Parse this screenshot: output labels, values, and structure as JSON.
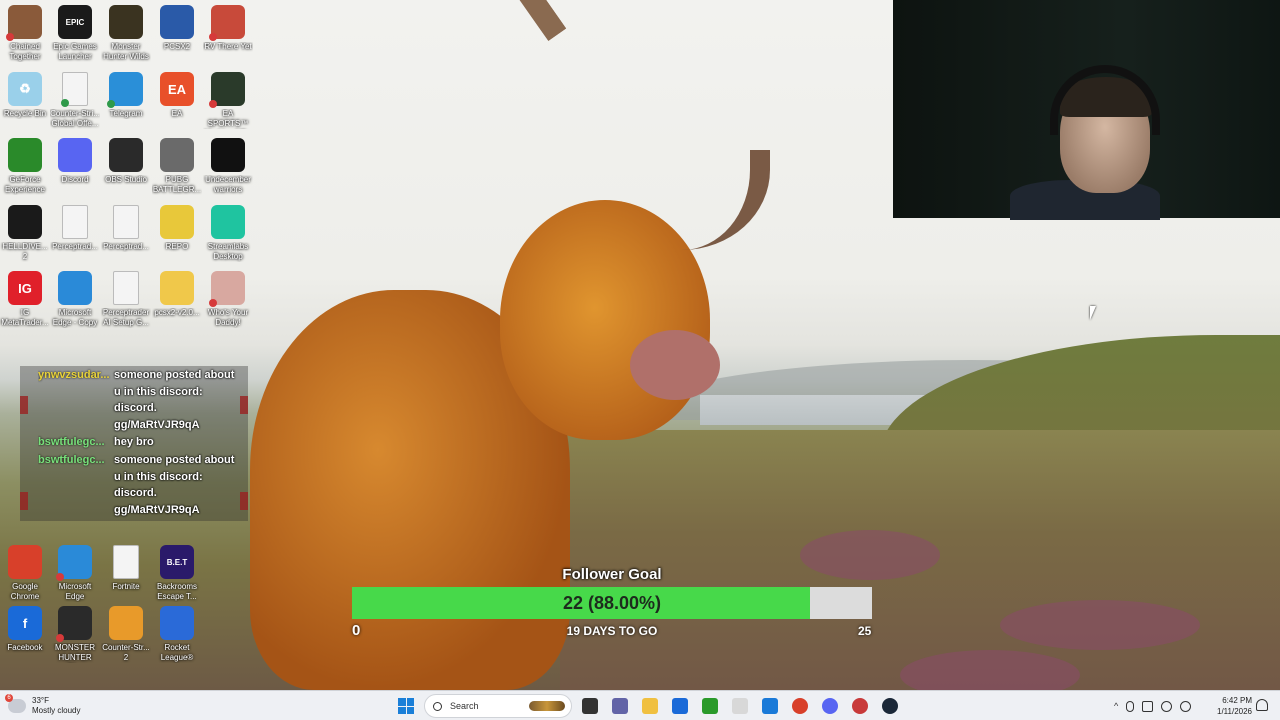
{
  "desktop_icons": [
    {
      "label": "Chained Together",
      "icon": "chained-together-icon",
      "color": "#8a5a3a",
      "glyph": "",
      "badge": "err"
    },
    {
      "label": "Epic Games Launcher",
      "icon": "epic-games-icon",
      "color": "#1a1a1a",
      "glyph": "EPIC",
      "badge": ""
    },
    {
      "label": "Monster Hunter Wilds",
      "icon": "monster-hunter-wilds-icon",
      "color": "#3a3320",
      "glyph": "",
      "badge": ""
    },
    {
      "label": "PCSX2",
      "icon": "pcsx2-icon",
      "color": "#2a5aa8",
      "glyph": "",
      "badge": ""
    },
    {
      "label": "RV There Yet",
      "icon": "rv-there-yet-icon",
      "color": "#c84a3a",
      "glyph": "",
      "badge": "err"
    },
    {
      "label": "Recycle Bin",
      "icon": "recycle-bin-icon",
      "color": "#9ad0ea",
      "glyph": "♻",
      "badge": ""
    },
    {
      "label": "Counter-Stri... Global Offe...",
      "icon": "document-icon",
      "color": "#f4f4f4",
      "glyph": "",
      "badge": "ok"
    },
    {
      "label": "Telegram",
      "icon": "telegram-icon",
      "color": "#2a8fd8",
      "glyph": "",
      "badge": "ok"
    },
    {
      "label": "EA",
      "icon": "ea-icon",
      "color": "#e8502a",
      "glyph": "EA",
      "badge": ""
    },
    {
      "label": "EA SPORTS™ Madden NF...",
      "icon": "madden-icon",
      "color": "#2a3a2a",
      "glyph": "",
      "badge": "err"
    },
    {
      "label": "GeForce Experience",
      "icon": "geforce-icon",
      "color": "#2a8a2a",
      "glyph": "",
      "badge": ""
    },
    {
      "label": "Discord",
      "icon": "discord-icon",
      "color": "#5865f2",
      "glyph": "",
      "badge": ""
    },
    {
      "label": "OBS Studio",
      "icon": "obs-icon",
      "color": "#2a2a2a",
      "glyph": "",
      "badge": ""
    },
    {
      "label": "PUBG BATTLEGR...",
      "icon": "pubg-icon",
      "color": "#6a6a6a",
      "glyph": "",
      "badge": ""
    },
    {
      "label": "Undecember warriors",
      "icon": "undecember-icon",
      "color": "#111111",
      "glyph": "",
      "badge": ""
    },
    {
      "label": "HELLDIVE... 2",
      "icon": "helldivers-icon",
      "color": "#1a1a1a",
      "glyph": "",
      "badge": ""
    },
    {
      "label": "Perceptrad...",
      "icon": "document-icon",
      "color": "#f4f4f4",
      "glyph": "",
      "badge": ""
    },
    {
      "label": "Perceptrad...",
      "icon": "document-icon",
      "color": "#f4f4f4",
      "glyph": "",
      "badge": ""
    },
    {
      "label": "REPO",
      "icon": "repo-icon",
      "color": "#e8c83a",
      "glyph": "",
      "badge": ""
    },
    {
      "label": "Streamlabs Desktop",
      "icon": "streamlabs-icon",
      "color": "#1fc4a0",
      "glyph": "",
      "badge": ""
    },
    {
      "label": "IG MetaTrader...",
      "icon": "ig-icon",
      "color": "#e0202a",
      "glyph": "IG",
      "badge": ""
    },
    {
      "label": "Microsoft Edge - Copy",
      "icon": "edge-icon",
      "color": "#2a8ad8",
      "glyph": "",
      "badge": ""
    },
    {
      "label": "Perceptrader AI Setup G...",
      "icon": "chrome-doc-icon",
      "color": "#f4f4f4",
      "glyph": "",
      "badge": ""
    },
    {
      "label": "pcsx2-v2.0...",
      "icon": "folder-icon",
      "color": "#f0c84a",
      "glyph": "",
      "badge": ""
    },
    {
      "label": "Who's Your Daddy!",
      "icon": "whos-your-daddy-icon",
      "color": "#d8a8a0",
      "glyph": "",
      "badge": "err"
    },
    {
      "label": "Google Chrome",
      "icon": "chrome-icon",
      "color": "#d8402a",
      "glyph": "",
      "badge": ""
    },
    {
      "label": "Microsoft Edge",
      "icon": "edge-icon",
      "color": "#2a8ad8",
      "glyph": "",
      "badge": "err"
    },
    {
      "label": "Fortnite",
      "icon": "document-icon",
      "color": "#f4f4f4",
      "glyph": "",
      "badge": ""
    },
    {
      "label": "Backrooms Escape T...",
      "icon": "backrooms-icon",
      "color": "#2a1a6a",
      "glyph": "B.E.T",
      "badge": ""
    },
    {
      "label": "Facebook",
      "icon": "facebook-icon",
      "color": "#1a6ad8",
      "glyph": "f",
      "badge": ""
    },
    {
      "label": "MONSTER HUNTER RI...",
      "icon": "monster-hunter-rise-icon",
      "color": "#2a2a2a",
      "glyph": "",
      "badge": "err"
    },
    {
      "label": "Counter-Str... 2",
      "icon": "counter-strike-icon",
      "color": "#e89a2a",
      "glyph": "",
      "badge": ""
    },
    {
      "label": "Rocket League®",
      "icon": "rocket-league-icon",
      "color": "#2a6ad8",
      "glyph": "",
      "badge": ""
    }
  ],
  "chat": {
    "messages": [
      {
        "user": "ynwvzsudar...",
        "text": "someone posted about u in this discord: discord. gg/MaRtVJR9qA",
        "user_color": "#e8d23a"
      },
      {
        "user": "bswtfulegc...",
        "text": "hey bro",
        "user_color": "#77e07a"
      },
      {
        "user": "bswtfulegc...",
        "text": "someone posted about u in this discord: discord. gg/MaRtVJR9qA",
        "user_color": "#77e07a"
      }
    ]
  },
  "follower_goal": {
    "title": "Follower Goal",
    "value_text": "22 (88.00%)",
    "current": 22,
    "target": 25,
    "progress_fraction": 0.88,
    "min_label": "0",
    "max_label": "25",
    "days_left": "19 DAYS TO GO",
    "fill_color": "#47d94a"
  },
  "taskbar": {
    "weather": {
      "temp": "33°F",
      "condition": "Mostly cloudy",
      "badge": "6"
    },
    "search_placeholder": "Search",
    "apps": [
      {
        "name": "task-view-icon",
        "color": "#333333"
      },
      {
        "name": "teams-icon",
        "color": "#6264a7"
      },
      {
        "name": "file-explorer-icon",
        "color": "#f0c040"
      },
      {
        "name": "store-icon",
        "color": "#1a6ad8"
      },
      {
        "name": "xbox-icon",
        "color": "#2a9a2a"
      },
      {
        "name": "notepad-icon",
        "color": "#d8d8d8"
      },
      {
        "name": "outlook-icon",
        "color": "#1a7ad8"
      },
      {
        "name": "chrome-icon",
        "color": "#d8402a"
      },
      {
        "name": "discord-icon",
        "color": "#5865f2"
      },
      {
        "name": "app-icon",
        "color": "#c83a3a"
      },
      {
        "name": "steam-icon",
        "color": "#1b2838"
      }
    ],
    "clock_time": "6:42 PM",
    "clock_date": "1/11/2026"
  }
}
